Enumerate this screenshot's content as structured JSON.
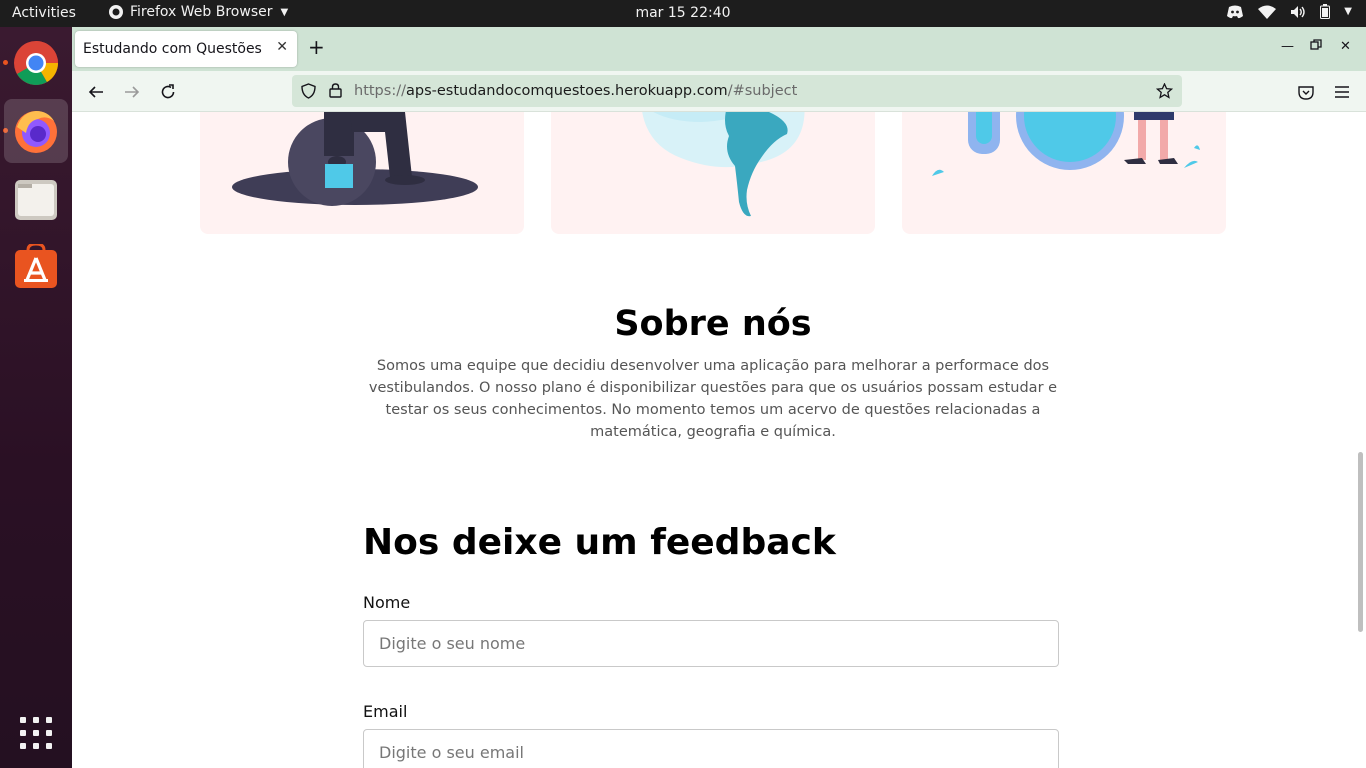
{
  "system": {
    "activities": "Activities",
    "app_name": "Firefox Web Browser",
    "clock": "mar 15  22:40"
  },
  "browser": {
    "tab_title": "Estudando com Questões",
    "url_scheme": "https://",
    "url_host": "aps-estudandocomquestoes.herokuapp.com",
    "url_path": "/#subject"
  },
  "about": {
    "title": "Sobre nós",
    "text": "Somos uma equipe que decidiu desenvolver uma aplicação para melhorar a performace dos vestibulandos. O nosso plano é disponibilizar questões para que os usuários possam estudar e testar os seus conhecimentos. No momento temos um acervo de questões relacionadas a matemática, geografia e química."
  },
  "feedback": {
    "title": "Nos deixe um feedback",
    "name_label": "Nome",
    "name_placeholder": "Digite o seu nome",
    "email_label": "Email",
    "email_placeholder": "Digite o seu email"
  },
  "colors": {
    "card_bg": "#fff2f2",
    "accent_cyan": "#4fc9e8",
    "tabstrip_bg": "#cfe3d4"
  }
}
